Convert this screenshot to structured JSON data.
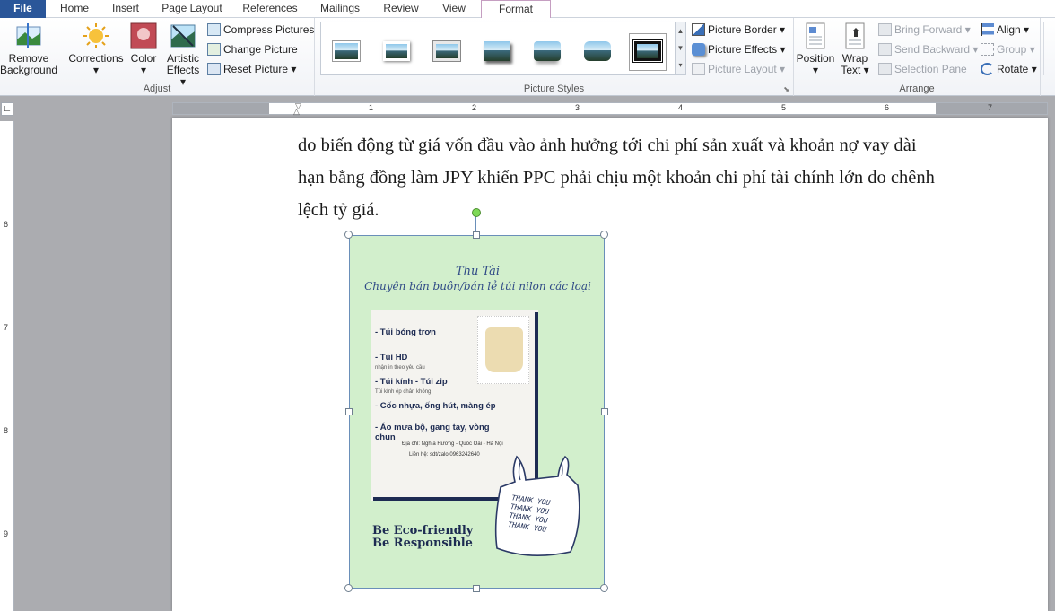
{
  "tabs": [
    "File",
    "Home",
    "Insert",
    "Page Layout",
    "References",
    "Mailings",
    "Review",
    "View"
  ],
  "active_tab": "Format",
  "adjust": {
    "remove_bg": [
      "Remove",
      "Background"
    ],
    "corrections": "Corrections",
    "color": "Color",
    "artistic": [
      "Artistic",
      "Effects"
    ],
    "compress": "Compress Pictures",
    "change": "Change Picture",
    "reset": "Reset Picture",
    "label": "Adjust"
  },
  "styles": {
    "border": "Picture Border",
    "effects": "Picture Effects",
    "layout": "Picture Layout",
    "label": "Picture Styles"
  },
  "arrange": {
    "position": "Position",
    "wrap": [
      "Wrap",
      "Text"
    ],
    "bring_forward": "Bring Forward",
    "send_backward": "Send Backward",
    "selection_pane": "Selection Pane",
    "align": "Align",
    "group": "Group",
    "rotate": "Rotate",
    "label": "Arrange"
  },
  "ruler_numbers": [
    "1",
    "2",
    "3",
    "4",
    "5",
    "6",
    "7"
  ],
  "vruler_numbers": [
    "6",
    "7",
    "8",
    "9"
  ],
  "document_lines": [
    "do biến động từ giá vốn đầu vào ảnh hưởng tới chi phí sản xuất và khoản nợ vay dài",
    "hạn bằng đồng làm JPY khiến PPC phải chịu một khoản chi phí tài chính lớn do chênh",
    "lệch tỷ giá."
  ],
  "poster": {
    "name": "Thu Tài",
    "tagline": "Chuyên bán buôn/bán lẻ túi nilon các loại",
    "items": [
      {
        "title": "- Túi bóng trơn",
        "note": ""
      },
      {
        "title": "- Túi HD",
        "note": "nhận in theo yêu cầu"
      },
      {
        "title": "- Túi kính - Túi zip",
        "note": "Túi kính ép chân không"
      },
      {
        "title": "- Cốc nhựa, ống hút, màng ép",
        "note": ""
      },
      {
        "title": "- Áo mưa bộ, gang tay, vòng",
        "note": ""
      },
      {
        "title": "chun",
        "note": ""
      }
    ],
    "address": "Địa chỉ: Nghĩa Hương - Quốc Oai - Hà Nội",
    "contact": "Liên hệ: sdt/zalo 0963242640",
    "slogan1": "Be Eco-friendly",
    "slogan2": "Be Responsible",
    "bag_text": [
      "THANK YOU",
      "THANK YOU",
      "THANK YOU",
      "THANK YOU"
    ]
  },
  "colors": {
    "file_tab": "#2a5699",
    "poster_bg": "#d2efcc",
    "poster_navy": "#1d2b52",
    "selection": "#6a8fb9",
    "rotate_handle": "#7ed957"
  }
}
